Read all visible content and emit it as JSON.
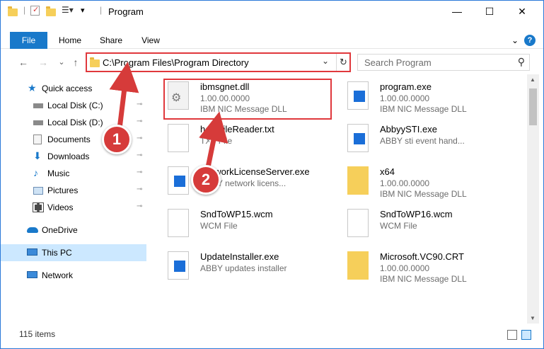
{
  "window": {
    "title": "Program",
    "min_glyph": "—",
    "max_glyph": "☐",
    "close_glyph": "✕"
  },
  "ribbon": {
    "tabs": [
      "File",
      "Home",
      "Share",
      "View"
    ],
    "expand_glyph": "⌄",
    "help_glyph": "?"
  },
  "nav": {
    "back": "←",
    "forward": "→",
    "recent": "⌄",
    "up": "↑"
  },
  "address": {
    "path": "C:\\Program Files\\Program Directory",
    "dropdown_glyph": "⌄",
    "refresh_glyph": "↻"
  },
  "search": {
    "placeholder": "Search Program",
    "icon_glyph": "⚲"
  },
  "sidebar": {
    "items": [
      {
        "label": "Quick access",
        "icon": "star-icon"
      },
      {
        "label": "Local Disk (C:)",
        "icon": "drive-icon",
        "pinned": true
      },
      {
        "label": "Local Disk (D:)",
        "icon": "drive-icon",
        "pinned": true
      },
      {
        "label": "Documents",
        "icon": "documents-icon",
        "pinned": true
      },
      {
        "label": "Downloads",
        "icon": "downloads-icon",
        "pinned": true
      },
      {
        "label": "Music",
        "icon": "music-icon",
        "pinned": true
      },
      {
        "label": "Pictures",
        "icon": "pictures-icon",
        "pinned": true
      },
      {
        "label": "Videos",
        "icon": "videos-icon",
        "pinned": true
      },
      {
        "label": "OneDrive",
        "icon": "onedrive-icon"
      },
      {
        "label": "This PC",
        "icon": "pc-icon",
        "selected": true
      },
      {
        "label": "Network",
        "icon": "network-icon"
      }
    ],
    "pin_glyph": "📌"
  },
  "files": [
    {
      "name": "ibmsgnet.dll",
      "line2": "1.00.00.0000",
      "line3": "IBM NIC Message DLL",
      "icon": "gear"
    },
    {
      "name": "program.exe",
      "line2": "1.00.00.0000",
      "line3": "IBM NIC Message DLL",
      "icon": "app"
    },
    {
      "name": "helpFileReader.txt",
      "line2": "TXT File",
      "line3": "",
      "icon": "doc"
    },
    {
      "name": "AbbyySTI.exe",
      "line2": "ABBY sti event hand...",
      "line3": "",
      "icon": "app"
    },
    {
      "name": "NetworkLicenseServer.exe",
      "line2": "ABBY network licens...",
      "line3": "",
      "icon": "app"
    },
    {
      "name": "x64",
      "line2": "1.00.00.0000",
      "line3": "IBM NIC Message DLL",
      "icon": "folder"
    },
    {
      "name": "SndToWP15.wcm",
      "line2": "WCM File",
      "line3": "",
      "icon": "doc"
    },
    {
      "name": "SndToWP16.wcm",
      "line2": "WCM File",
      "line3": "",
      "icon": "doc"
    },
    {
      "name": "UpdateInstaller.exe",
      "line2": "ABBY updates installer",
      "line3": "",
      "icon": "app"
    },
    {
      "name": "Microsoft.VC90.CRT",
      "line2": "1.00.00.0000",
      "line3": "IBM NIC Message DLL",
      "icon": "folder"
    }
  ],
  "status": {
    "count": "115 items"
  },
  "callouts": [
    "1",
    "2"
  ],
  "colors": {
    "accent": "#1979ca",
    "highlight": "#e0383c",
    "callout": "#d63b3a"
  }
}
